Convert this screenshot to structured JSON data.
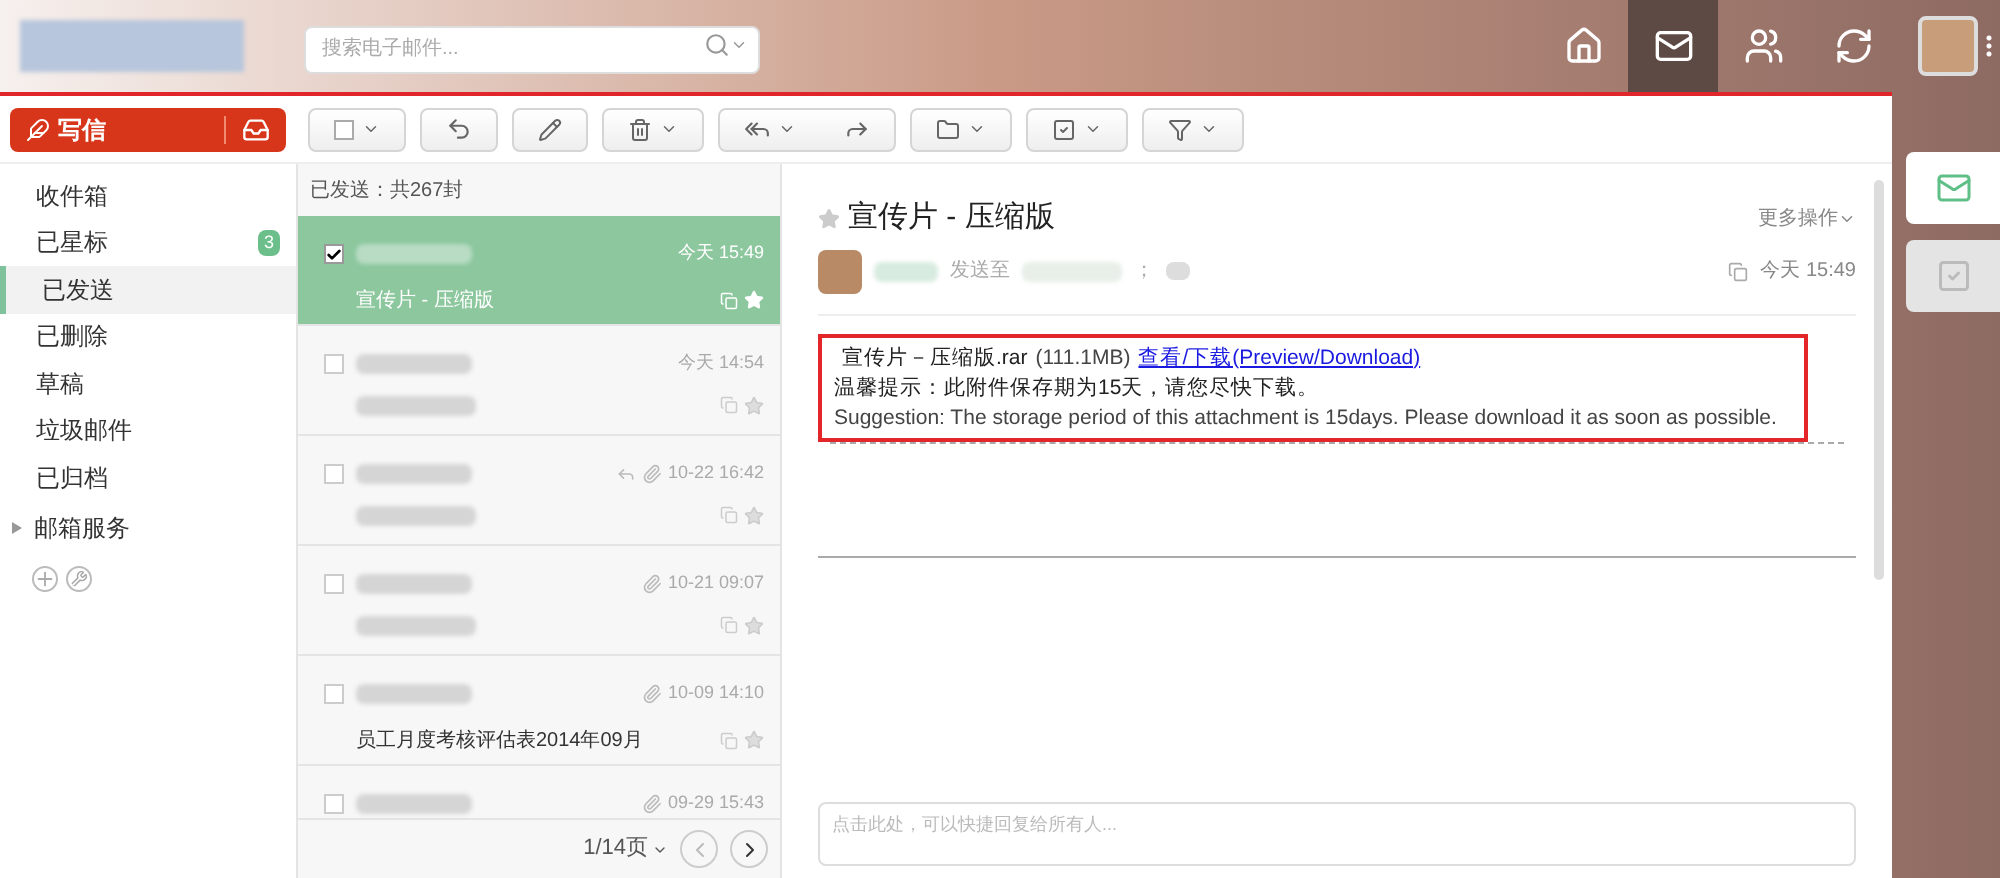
{
  "search": {
    "placeholder": "搜索电子邮件..."
  },
  "nav": [
    {
      "selected": false
    },
    {
      "selected": true
    },
    {
      "selected": false
    },
    {
      "selected": false
    }
  ],
  "compose": {
    "label": "写信"
  },
  "folders": [
    {
      "label": "收件箱",
      "selected": false
    },
    {
      "label": "已星标",
      "selected": false,
      "count": "3"
    },
    {
      "label": "已发送",
      "selected": true
    },
    {
      "label": "已删除",
      "selected": false
    },
    {
      "label": "草稿",
      "selected": false
    },
    {
      "label": "垃圾邮件",
      "selected": false
    },
    {
      "label": "已归档",
      "selected": false
    }
  ],
  "services": {
    "label": "邮箱服务",
    "expanded": false
  },
  "list_header": "已发送：共267封",
  "messages": [
    {
      "time": "今天 15:49",
      "subject": "宣传片 - 压缩版",
      "checked": true,
      "selected": true,
      "replied": false,
      "attachment": false
    },
    {
      "time": "今天 14:54",
      "checked": false,
      "selected": false,
      "replied": false,
      "attachment": false
    },
    {
      "time": "10-22 16:42",
      "checked": false,
      "selected": false,
      "replied": true,
      "attachment": true
    },
    {
      "time": "10-21 09:07",
      "checked": false,
      "selected": false,
      "replied": false,
      "attachment": true
    },
    {
      "time": "10-09 14:10",
      "subject": "员工月度考核评估表2014年09月",
      "checked": false,
      "selected": false,
      "replied": false,
      "attachment": true
    },
    {
      "time": "09-29 15:43",
      "checked": false,
      "selected": false,
      "replied": false,
      "attachment": true
    }
  ],
  "pager": {
    "page": "1/14页"
  },
  "mail": {
    "title": "宣传片 - 压缩版",
    "more": "更多操作",
    "sent_to": "发送至",
    "separator": "；",
    "time": "今天 15:49",
    "attachment": {
      "name": "宣传片－压缩版.rar",
      "size": "(111.1MB)",
      "link": "查看/下载(Preview/Download)"
    },
    "notice_cn": "温馨提示：此附件保存期为15天，请您尽快下载。",
    "notice_en": "Suggestion: The storage period of this attachment is 15days. Please download it as soon as possible."
  },
  "reply": {
    "placeholder": "点击此处，可以快捷回复给所有人..."
  },
  "rail": [
    {
      "selected": true
    },
    {
      "selected": false
    }
  ]
}
